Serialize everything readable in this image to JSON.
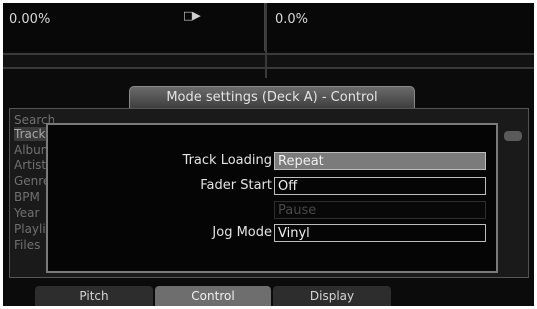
{
  "deck_left": {
    "pitch": "0.00%",
    "play_indicator": "□▶"
  },
  "deck_right": {
    "pitch": "0.0%"
  },
  "dialog_title": "Mode settings (Deck A) - Control",
  "background_list": [
    "Search",
    "Track",
    "Album",
    "Artist",
    "Genre",
    "BPM",
    "Year",
    "Playlist",
    "Files"
  ],
  "settings": {
    "track_loading": {
      "label": "Track Loading",
      "value": "Repeat"
    },
    "fader_start": {
      "label": "Fader Start",
      "value": "Off"
    },
    "pause": {
      "value": "Pause"
    },
    "jog_mode": {
      "label": "Jog Mode",
      "value": "Vinyl"
    }
  },
  "tabs": [
    {
      "label": "Pitch",
      "active": false
    },
    {
      "label": "Control",
      "active": true
    },
    {
      "label": "Display",
      "active": false
    }
  ],
  "colors": {
    "background": "#0b0b0b",
    "highlight": "#7b7b7b",
    "text": "#e4e4e4"
  }
}
